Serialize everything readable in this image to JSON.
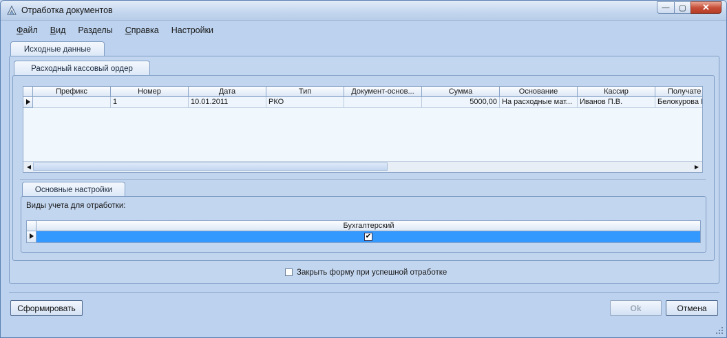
{
  "window": {
    "title": "Отработка документов",
    "close_glyph": "✕",
    "min_glyph": "—",
    "max_glyph": "▢"
  },
  "menu": {
    "items": [
      {
        "label": "Файл",
        "u": "Ф",
        "rest": "айл"
      },
      {
        "label": "Вид",
        "u": "В",
        "rest": "ид"
      },
      {
        "label": "Разделы",
        "u": "",
        "rest": "Разделы"
      },
      {
        "label": "Справка",
        "u": "С",
        "rest": "правка"
      },
      {
        "label": "Настройки",
        "u": "",
        "rest": "Настройки"
      }
    ]
  },
  "tabs": {
    "source": "Исходные данные",
    "doc": "Расходный кассовый ордер",
    "settings": "Основные настройки"
  },
  "doc_grid": {
    "columns": [
      "Префикс",
      "Номер",
      "Дата",
      "Тип",
      "Документ-основ...",
      "Сумма",
      "Основание",
      "Кассир",
      "Получате"
    ],
    "rows": [
      [
        "",
        "1",
        "10.01.2011",
        "РКО",
        "",
        "5000,00",
        "На расходные мат...",
        "Иванов П.В.",
        "Белокурова В"
      ]
    ]
  },
  "settings": {
    "label": "Виды учета для отработки:",
    "column": "Бухгалтерский",
    "checked": true,
    "check_glyph": "✔"
  },
  "close_on_success": {
    "label": "Закрыть форму при успешной отработке",
    "checked": false
  },
  "buttons": {
    "generate": "Сформировать",
    "ok": "Ok",
    "cancel": "Отмена"
  },
  "colors": {
    "selected_row": "#3399ff",
    "window_bg": "#bcd2ee"
  }
}
